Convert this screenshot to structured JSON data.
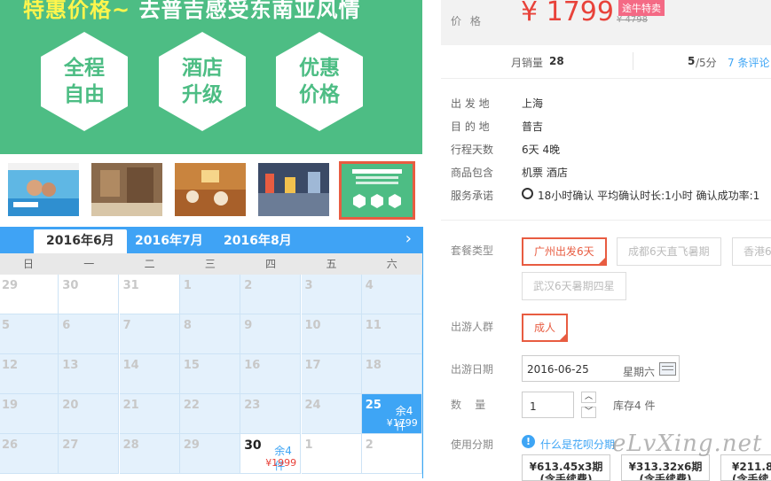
{
  "banner": {
    "title_yellow": "特惠价格~",
    "title_white": "去普吉感受东南亚风情",
    "hexes": [
      [
        "全程",
        "自由"
      ],
      [
        "酒店",
        "升级"
      ],
      [
        "优惠",
        "价格"
      ]
    ]
  },
  "calendar": {
    "tabs": [
      "2016年6月",
      "2016年7月",
      "2016年8月"
    ],
    "next": "›",
    "weekdays": [
      "日",
      "一",
      "二",
      "三",
      "四",
      "五",
      "六"
    ],
    "rows": [
      [
        {
          "d": "29",
          "t": "w"
        },
        {
          "d": "30",
          "t": "w"
        },
        {
          "d": "31",
          "t": "w"
        },
        {
          "d": "1"
        },
        {
          "d": "2"
        },
        {
          "d": "3"
        },
        {
          "d": "4"
        }
      ],
      [
        {
          "d": "5"
        },
        {
          "d": "6"
        },
        {
          "d": "7"
        },
        {
          "d": "8"
        },
        {
          "d": "9"
        },
        {
          "d": "10"
        },
        {
          "d": "11"
        }
      ],
      [
        {
          "d": "12"
        },
        {
          "d": "13"
        },
        {
          "d": "14"
        },
        {
          "d": "15"
        },
        {
          "d": "16"
        },
        {
          "d": "17"
        },
        {
          "d": "18"
        }
      ],
      [
        {
          "d": "19"
        },
        {
          "d": "20"
        },
        {
          "d": "21"
        },
        {
          "d": "22"
        },
        {
          "d": "23"
        },
        {
          "d": "24"
        },
        {
          "d": "25",
          "t": "sel",
          "stock": "余4件",
          "price": "¥1799"
        }
      ],
      [
        {
          "d": "26"
        },
        {
          "d": "27"
        },
        {
          "d": "28"
        },
        {
          "d": "29"
        },
        {
          "d": "30",
          "t": "dark",
          "stock": "余4件",
          "price": "¥1999"
        },
        {
          "d": "1",
          "t": "w"
        },
        {
          "d": "2",
          "t": "w"
        }
      ]
    ]
  },
  "price": {
    "label": "价  格",
    "value": "¥ 1799",
    "badge": "途牛特卖",
    "old": "¥ 4798"
  },
  "stats": {
    "sales_label": "月销量",
    "sales": "28",
    "score": "5",
    "score_total": "/5分",
    "reviews": "7 条评论"
  },
  "info": [
    {
      "k": "出 发 地",
      "v": "上海"
    },
    {
      "k": "目 的 地",
      "v": "普吉"
    },
    {
      "k": "行程天数",
      "v": "6天 4晚"
    },
    {
      "k": "商品包含",
      "v": "机票  酒店"
    },
    {
      "k": "服务承诺",
      "v": "18小时确认    平均确认时长:1小时    确认成功率:1"
    }
  ],
  "package": {
    "label": "套餐类型",
    "options": [
      "广州出发6天",
      "成都6天直飞暑期",
      "香港6",
      "武汉6天暑期四星"
    ]
  },
  "crowd": {
    "label": "出游人群",
    "option": "成人"
  },
  "date": {
    "label": "出游日期",
    "value": "2016-06-25",
    "weekday": "星期六"
  },
  "qty": {
    "label": "数    量",
    "value": "1",
    "stock": "库存4 件"
  },
  "installment": {
    "label": "使用分期",
    "link": "什么是花呗分期",
    "plans": [
      {
        "a": "¥613.45x3期",
        "b": "(含手续费)"
      },
      {
        "a": "¥313.32x6期",
        "b": "(含手续费)"
      },
      {
        "a": "¥211.8",
        "b": "(含手续"
      }
    ]
  },
  "watermark": "eLvXing.net",
  "colors": {
    "green": "#4dbd84",
    "blue": "#3fa3f5",
    "red": "#e8423a",
    "orange": "#e85c41"
  }
}
